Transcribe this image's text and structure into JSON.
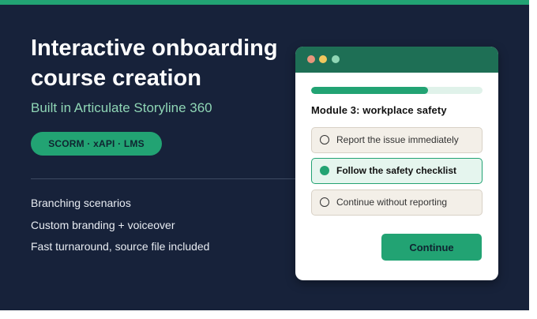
{
  "hero": {
    "title": "Interactive onboarding course creation",
    "subtitle": "Built in Articulate Storyline 360",
    "badge": "SCORM · xAPI · LMS",
    "features": [
      "Branching scenarios",
      "Custom branding + voiceover",
      "Fast turnaround, source file included"
    ]
  },
  "colors": {
    "background": "#17223a",
    "accent": "#22a373",
    "subtitle": "#8fd6b5",
    "card_header": "#1e6f55",
    "option_bg": "#f3efe8",
    "selected_bg": "#e5f5ee"
  },
  "course_card": {
    "window_dots": [
      "red-dot",
      "yellow-dot",
      "green-dot"
    ],
    "progress_fraction": 0.68,
    "module_title": "Module 3: workplace safety",
    "options": [
      {
        "label": "Report the issue immediately",
        "selected": false
      },
      {
        "label": "Follow the safety checklist",
        "selected": true
      },
      {
        "label": "Continue without reporting",
        "selected": false
      }
    ],
    "continue_label": "Continue"
  }
}
